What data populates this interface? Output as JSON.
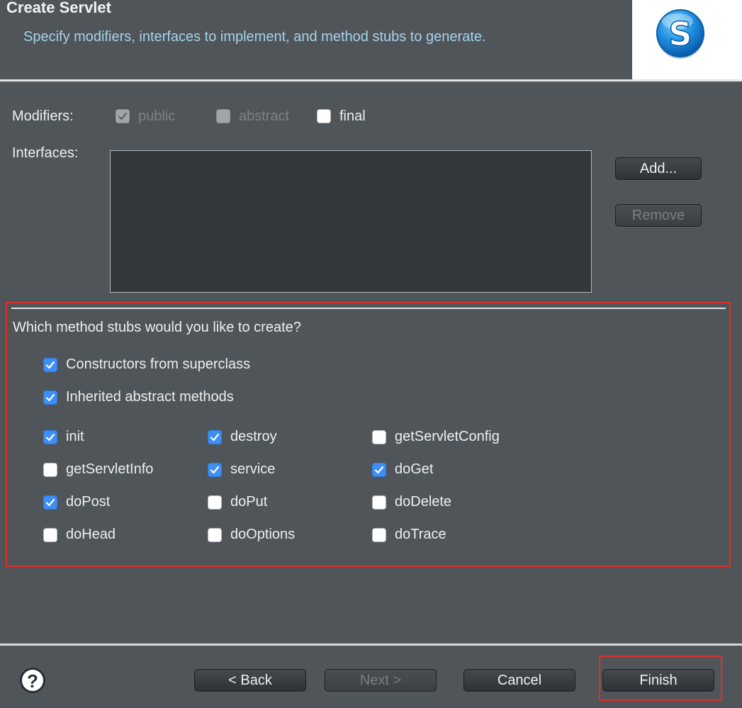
{
  "header": {
    "title": "Create Servlet",
    "subtitle": "Specify modifiers, interfaces to implement, and method stubs to generate.",
    "logo_icon": "servlet-s-logo-icon"
  },
  "modifiers": {
    "label": "Modifiers:",
    "public": {
      "label": "public",
      "checked": true,
      "enabled": false
    },
    "abstract": {
      "label": "abstract",
      "checked": false,
      "enabled": false
    },
    "final": {
      "label": "final",
      "checked": false,
      "enabled": true
    }
  },
  "interfaces": {
    "label": "Interfaces:",
    "items": [],
    "add_label": "Add...",
    "remove_label": "Remove"
  },
  "stubs": {
    "question": "Which method stubs would you like to create?",
    "constructors": {
      "label": "Constructors from superclass",
      "checked": true
    },
    "inherited": {
      "label": "Inherited abstract methods",
      "checked": true
    },
    "methods": [
      {
        "label": "init",
        "checked": true
      },
      {
        "label": "destroy",
        "checked": true
      },
      {
        "label": "getServletConfig",
        "checked": false
      },
      {
        "label": "getServletInfo",
        "checked": false
      },
      {
        "label": "service",
        "checked": true
      },
      {
        "label": "doGet",
        "checked": true
      },
      {
        "label": "doPost",
        "checked": true
      },
      {
        "label": "doPut",
        "checked": false
      },
      {
        "label": "doDelete",
        "checked": false
      },
      {
        "label": "doHead",
        "checked": false
      },
      {
        "label": "doOptions",
        "checked": false
      },
      {
        "label": "doTrace",
        "checked": false
      }
    ]
  },
  "footer": {
    "help_label": "?",
    "back_label": "< Back",
    "next_label": "Next >",
    "cancel_label": "Cancel",
    "finish_label": "Finish"
  },
  "colors": {
    "background": "#50555a",
    "accent_check": "#3d8ef7",
    "highlight": "#e0302a",
    "subtitle": "#a6d2ec"
  }
}
